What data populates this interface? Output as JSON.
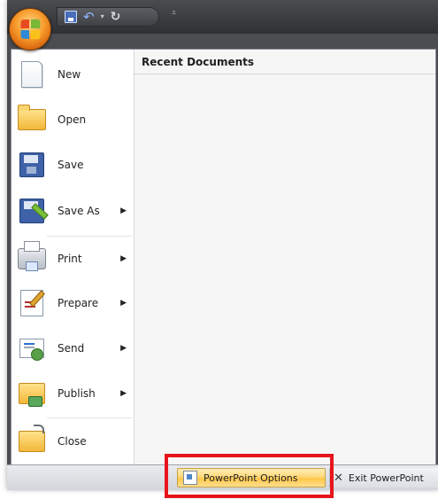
{
  "quick_access_toolbar": {
    "save_icon": "save-icon",
    "undo_icon": "undo-icon",
    "redo_icon": "redo-icon",
    "customize_glyph": "⩡"
  },
  "office_button": {
    "icon": "office-logo-icon"
  },
  "menu": {
    "items": [
      {
        "label": "New",
        "has_submenu": false
      },
      {
        "label": "Open",
        "has_submenu": false
      },
      {
        "label": "Save",
        "has_submenu": false
      },
      {
        "label": "Save As",
        "has_submenu": true
      },
      {
        "label": "Print",
        "has_submenu": true
      },
      {
        "label": "Prepare",
        "has_submenu": true
      },
      {
        "label": "Send",
        "has_submenu": true
      },
      {
        "label": "Publish",
        "has_submenu": true
      },
      {
        "label": "Close",
        "has_submenu": false
      }
    ],
    "submenu_arrow": "▶"
  },
  "recent_documents": {
    "title": "Recent Documents"
  },
  "bottom": {
    "options_label": "PowerPoint Options",
    "exit_label": "Exit PowerPoint",
    "exit_glyph": "✕"
  },
  "colors": {
    "highlight_box": "#e8141c",
    "options_button": "#ffd97a"
  }
}
